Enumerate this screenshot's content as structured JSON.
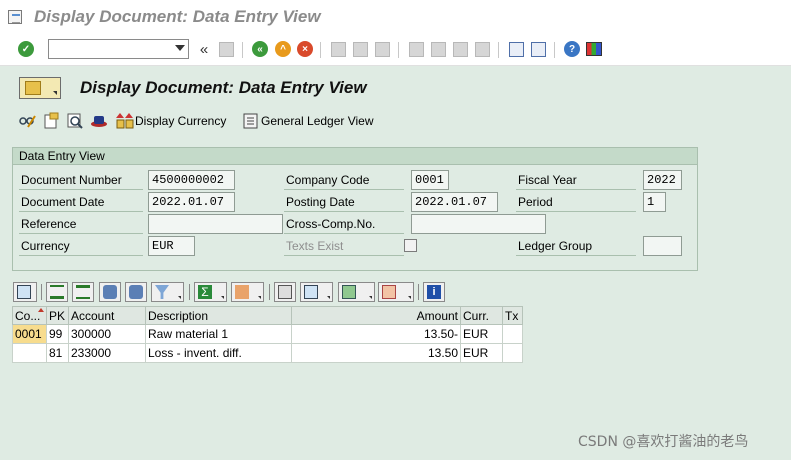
{
  "window": {
    "title": "Display Document: Data Entry View"
  },
  "system_toolbar": {
    "command_field_value": "",
    "icons": [
      "enter-icon",
      "save-icon",
      "back-icon",
      "exit-icon",
      "cancel-icon",
      "print-icon",
      "find-icon",
      "find-next-icon",
      "first-page-icon",
      "previous-page-icon",
      "next-page-icon",
      "last-page-icon",
      "new-session-icon",
      "shortcut-icon",
      "help-icon",
      "customize-layout-icon"
    ]
  },
  "screen": {
    "title": "Display Document: Data Entry View"
  },
  "app_toolbar": {
    "display_currency_label": "Display Currency",
    "general_ledger_view_label": "General Ledger View"
  },
  "header_group": {
    "title": "Data Entry View",
    "document_number_label": "Document Number",
    "document_number_value": "4500000002",
    "company_code_label": "Company Code",
    "company_code_value": "0001",
    "fiscal_year_label": "Fiscal Year",
    "fiscal_year_value": "2022",
    "document_date_label": "Document Date",
    "document_date_value": "2022.01.07",
    "posting_date_label": "Posting Date",
    "posting_date_value": "2022.01.07",
    "period_label": "Period",
    "period_value": "1",
    "reference_label": "Reference",
    "reference_value": "",
    "cross_comp_label": "Cross-Comp.No.",
    "cross_comp_value": "",
    "currency_label": "Currency",
    "currency_value": "EUR",
    "texts_exist_label": "Texts Exist",
    "texts_exist_checked": false,
    "ledger_group_label": "Ledger Group",
    "ledger_group_value": ""
  },
  "items_table": {
    "columns": [
      "Co...",
      "PK",
      "Account",
      "Description",
      "Amount",
      "Curr.",
      "Tx"
    ],
    "rows": [
      {
        "co": "0001",
        "pk": "99",
        "account": "300000",
        "description": "Raw material 1",
        "amount": "13.50-",
        "curr": "EUR",
        "tx": ""
      },
      {
        "co": "",
        "pk": "81",
        "account": "233000",
        "description": "Loss - invent. diff.",
        "amount": "13.50",
        "curr": "EUR",
        "tx": ""
      }
    ]
  },
  "watermark": "CSDN @喜欢打酱油的老鸟",
  "colors": {
    "background": "#dfebe3",
    "key_cell": "#f7dc8e",
    "enter_green": "#3c9a3c",
    "exit_orange": "#e89a1c",
    "cancel_red": "#d94a2b",
    "help_blue": "#3a76c4"
  }
}
